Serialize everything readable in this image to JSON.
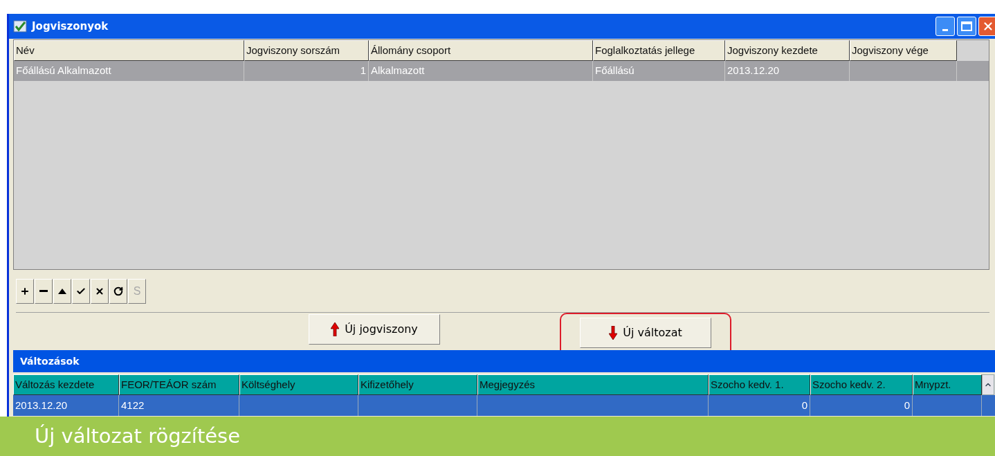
{
  "window": {
    "title": "Jogviszonyok"
  },
  "upper_table": {
    "columns": [
      {
        "label": "Név",
        "numeric": false
      },
      {
        "label": "Jogviszony sorszám",
        "numeric": true
      },
      {
        "label": "Állomány csoport",
        "numeric": false
      },
      {
        "label": "Foglalkoztatás jellege",
        "numeric": false
      },
      {
        "label": "Jogviszony kezdete",
        "numeric": false
      },
      {
        "label": "Jogviszony vége"
      }
    ],
    "rows": [
      {
        "selected": true,
        "cells": [
          "Főállású Alkalmazott",
          "1",
          "Alkalmazott",
          "Főállású",
          "2013.12.20",
          ""
        ]
      }
    ]
  },
  "toolbar": [
    {
      "kind": "add",
      "disabled": false
    },
    {
      "kind": "remove",
      "disabled": false
    },
    {
      "kind": "up",
      "disabled": false
    },
    {
      "kind": "confirm",
      "disabled": false
    },
    {
      "kind": "cancel",
      "disabled": false
    },
    {
      "kind": "refresh",
      "disabled": false
    },
    {
      "kind": "text",
      "label": "S",
      "disabled": true
    }
  ],
  "actions": [
    {
      "label": "Új jogviszony",
      "kind": "up",
      "highlighted": false
    },
    {
      "label": "Új változat",
      "kind": "down",
      "highlighted": true
    }
  ],
  "changes": {
    "title": "Változások",
    "columns": [
      {
        "label": "Változás kezdete",
        "numeric": false
      },
      {
        "label": "FEOR/TEÁOR szám",
        "numeric": false
      },
      {
        "label": "Költséghely"
      },
      {
        "label": "Kifizetőhely"
      },
      {
        "label": "Megjegyzés"
      },
      {
        "label": "Szocho kedv. 1.",
        "numeric": true
      },
      {
        "label": "Szocho kedv. 2.",
        "numeric": true
      },
      {
        "label": "Mnypzt."
      }
    ],
    "rows": [
      {
        "selected": true,
        "cells": [
          "2013.12.20",
          "4122",
          "",
          "",
          "",
          "0",
          "0",
          ""
        ]
      }
    ]
  },
  "caption": "Új változat rögzítése"
}
